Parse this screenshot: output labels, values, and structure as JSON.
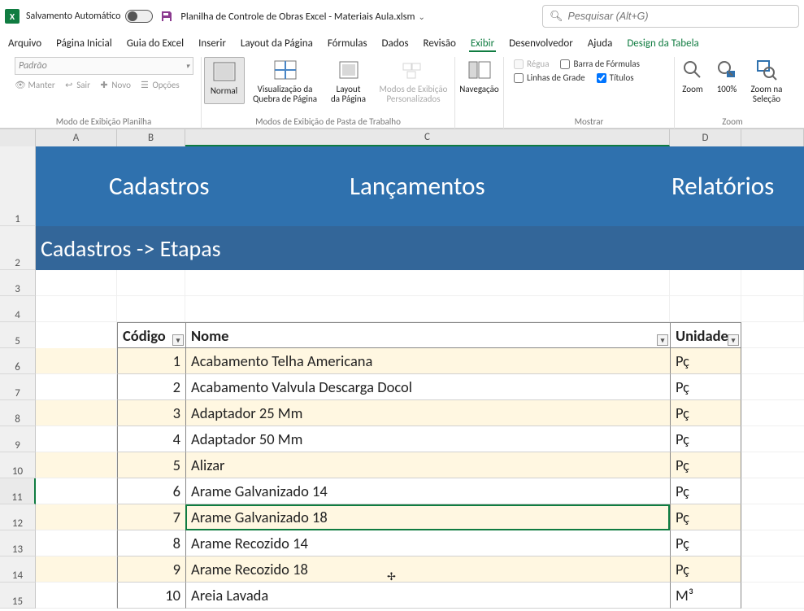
{
  "titlebar": {
    "autosave_label": "Salvamento Automático",
    "filename": "Planilha de Controle de Obras Excel - Materiais Aula.xlsm",
    "search_placeholder": "Pesquisar (Alt+G)"
  },
  "menu": {
    "arquivo": "Arquivo",
    "pagina_inicial": "Página Inicial",
    "guia_excel": "Guia do Excel",
    "inserir": "Inserir",
    "layout": "Layout da Página",
    "formulas": "Fórmulas",
    "dados": "Dados",
    "revisao": "Revisão",
    "exibir": "Exibir",
    "desenvolvedor": "Desenvolvedor",
    "ajuda": "Ajuda",
    "design": "Design da Tabela"
  },
  "ribbon": {
    "planilha": {
      "dropdown": "Padrão",
      "manter": "Manter",
      "sair": "Sair",
      "novo": "Novo",
      "opcoes": "Opções",
      "group": "Modo de Exibição Planilha"
    },
    "views": {
      "normal": "Normal",
      "quebra": "Visualização da\nQuebra de Página",
      "layout_pagina": "Layout\nda Página",
      "personalizados": "Modos de Exibição\nPersonalizados",
      "group": "Modos de Exibição de Pasta de Trabalho"
    },
    "nav": {
      "navegacao": "Navegação"
    },
    "mostrar": {
      "regua": "Régua",
      "linhas": "Linhas de Grade",
      "formulas": "Barra de Fórmulas",
      "titulos": "Títulos",
      "group": "Mostrar"
    },
    "zoom": {
      "zoom": "Zoom",
      "cem": "100%",
      "selecao": "Zoom na\nSeleção",
      "group": "Zoom"
    }
  },
  "columns": {
    "a": "A",
    "b": "B",
    "c": "C",
    "d": "D"
  },
  "rows": [
    "1",
    "2",
    "3",
    "4",
    "5",
    "6",
    "7",
    "8",
    "9",
    "10",
    "11",
    "12",
    "13",
    "14",
    "15"
  ],
  "banner": {
    "cadastros": "Cadastros",
    "lancamentos": "Lançamentos",
    "relatorios": "Relatórios",
    "breadcrumb": "Cadastros -> Etapas"
  },
  "table": {
    "col_codigo": "Código",
    "col_nome": "Nome",
    "col_unidade": "Unidade",
    "rows": [
      {
        "code": "1",
        "nome": "Acabamento Telha Americana",
        "un": "Pç"
      },
      {
        "code": "2",
        "nome": "Acabamento Valvula Descarga Docol",
        "un": "Pç"
      },
      {
        "code": "3",
        "nome": "Adaptador 25 Mm",
        "un": "Pç"
      },
      {
        "code": "4",
        "nome": "Adaptador 50 Mm",
        "un": "Pç"
      },
      {
        "code": "5",
        "nome": "Alizar",
        "un": "Pç"
      },
      {
        "code": "6",
        "nome": "Arame Galvanizado 14",
        "un": "Pç"
      },
      {
        "code": "7",
        "nome": "Arame Galvanizado 18",
        "un": "Pç"
      },
      {
        "code": "8",
        "nome": "Arame Recozido 14",
        "un": "Pç"
      },
      {
        "code": "9",
        "nome": "Arame Recozido 18",
        "un": "Pç"
      },
      {
        "code": "10",
        "nome": "Areia Lavada",
        "un": "M³"
      }
    ]
  }
}
